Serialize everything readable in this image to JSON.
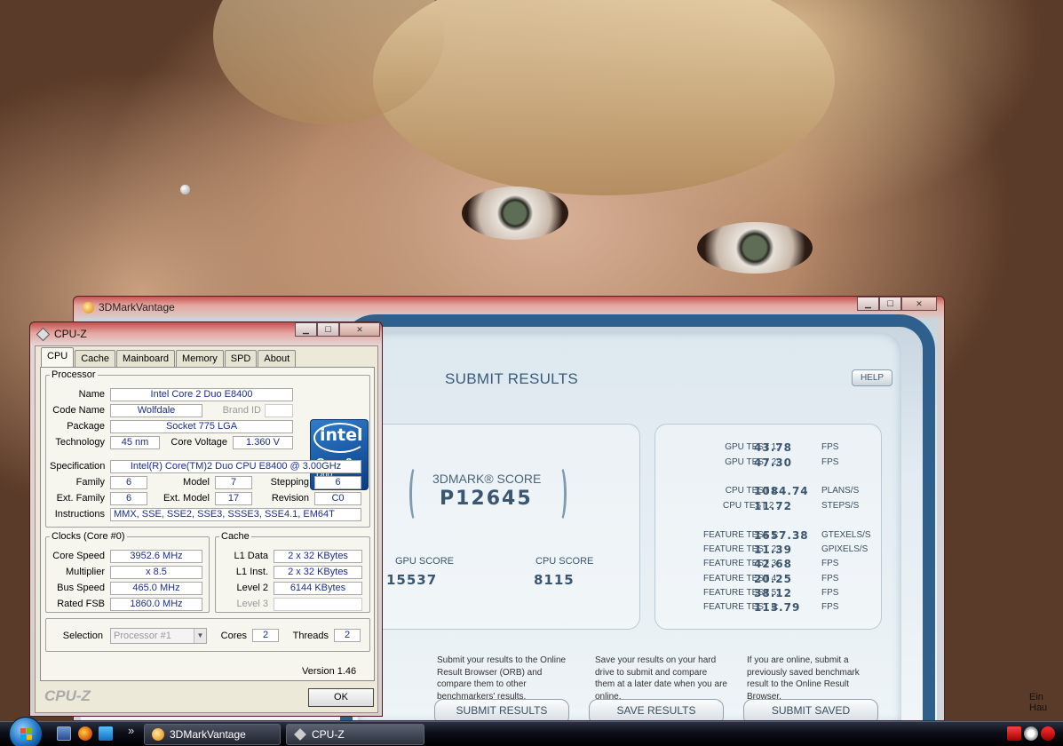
{
  "wallpaper": {
    "corner_text": "Ein Hau"
  },
  "mark3d": {
    "window_title": "3DMarkVantage",
    "header": "SUBMIT RESULTS",
    "help": "HELP",
    "score_label": "3DMARK® SCORE",
    "score": "P12645",
    "gpu_score_label": "GPU SCORE",
    "gpu_score": "15537",
    "cpu_score_label": "CPU SCORE",
    "cpu_score": "8115",
    "tests": [
      {
        "label": "GPU TEST 1:",
        "value": "43.78",
        "unit": "FPS"
      },
      {
        "label": "GPU TEST 2:",
        "value": "47.30",
        "unit": "FPS"
      },
      {
        "label": "CPU TEST 1:",
        "value": "1084.74",
        "unit": "PLANS/S"
      },
      {
        "label": "CPU TEST 2 :",
        "value": "11.72",
        "unit": "STEPS/S"
      },
      {
        "label": "FEATURE TEST 1:",
        "value": "1657.38",
        "unit": "GTEXELS/S"
      },
      {
        "label": "FEATURE TEST 2:",
        "value": "11.39",
        "unit": "GPIXELS/S"
      },
      {
        "label": "FEATURE TEST 3:",
        "value": "42.68",
        "unit": "FPS"
      },
      {
        "label": "FEATURE TEST 4:",
        "value": "20.25",
        "unit": "FPS"
      },
      {
        "label": "FEATURE TEST 5:",
        "value": "38.12",
        "unit": "FPS"
      },
      {
        "label": "FEATURE TEST 6:",
        "value": "113.79",
        "unit": "FPS"
      }
    ],
    "desc_submit": "Submit your results to the Online Result Browser (ORB) and compare them to other benchmarkers' results.",
    "desc_save": "Save your results on your hard drive to submit and compare them at a later date when you are online.",
    "desc_saved": "If you are online, submit a previously saved benchmark result to the Online Result Browser.",
    "btn_submit": "SUBMIT RESULTS",
    "btn_save": "SAVE RESULTS",
    "btn_saved": "SUBMIT SAVED"
  },
  "cpuz": {
    "window_title": "CPU-Z",
    "tabs": [
      "CPU",
      "Cache",
      "Mainboard",
      "Memory",
      "SPD",
      "About"
    ],
    "processor": {
      "legend": "Processor",
      "name_lbl": "Name",
      "name": "Intel Core 2 Duo E8400",
      "codename_lbl": "Code Name",
      "codename": "Wolfdale",
      "brandid_lbl": "Brand ID",
      "brandid": "",
      "package_lbl": "Package",
      "package": "Socket 775 LGA",
      "tech_lbl": "Technology",
      "tech": "45 nm",
      "voltage_lbl": "Core Voltage",
      "voltage": "1.360 V",
      "spec_lbl": "Specification",
      "spec": "Intel(R) Core(TM)2 Duo CPU     E8400  @ 3.00GHz",
      "family_lbl": "Family",
      "family": "6",
      "model_lbl": "Model",
      "model": "7",
      "stepping_lbl": "Stepping",
      "stepping": "6",
      "extfamily_lbl": "Ext. Family",
      "extfamily": "6",
      "extmodel_lbl": "Ext. Model",
      "extmodel": "17",
      "revision_lbl": "Revision",
      "revision": "C0",
      "instr_lbl": "Instructions",
      "instr": "MMX, SSE, SSE2, SSE3, SSSE3, SSE4.1, EM64T"
    },
    "logo": {
      "word": "intel",
      "line1": "Core 2",
      "line2": "Duo",
      "line3": "inside"
    },
    "clocks": {
      "legend": "Clocks (Core #0)",
      "speed_lbl": "Core Speed",
      "speed": "3952.6 MHz",
      "mult_lbl": "Multiplier",
      "mult": "x 8.5",
      "bus_lbl": "Bus Speed",
      "bus": "465.0 MHz",
      "fsb_lbl": "Rated FSB",
      "fsb": "1860.0 MHz"
    },
    "cache": {
      "legend": "Cache",
      "l1d_lbl": "L1 Data",
      "l1d": "2 x 32 KBytes",
      "l1i_lbl": "L1 Inst.",
      "l1i": "2 x 32 KBytes",
      "l2_lbl": "Level 2",
      "l2": "6144 KBytes",
      "l3_lbl": "Level 3",
      "l3": ""
    },
    "selection_lbl": "Selection",
    "selection": "Processor #1",
    "cores_lbl": "Cores",
    "cores": "2",
    "threads_lbl": "Threads",
    "threads": "2",
    "version": "Version 1.46",
    "brand": "CPU-Z",
    "ok": "OK"
  },
  "taskbar": {
    "task1": "3DMarkVantage",
    "task2": "CPU-Z",
    "chevron": "»"
  }
}
